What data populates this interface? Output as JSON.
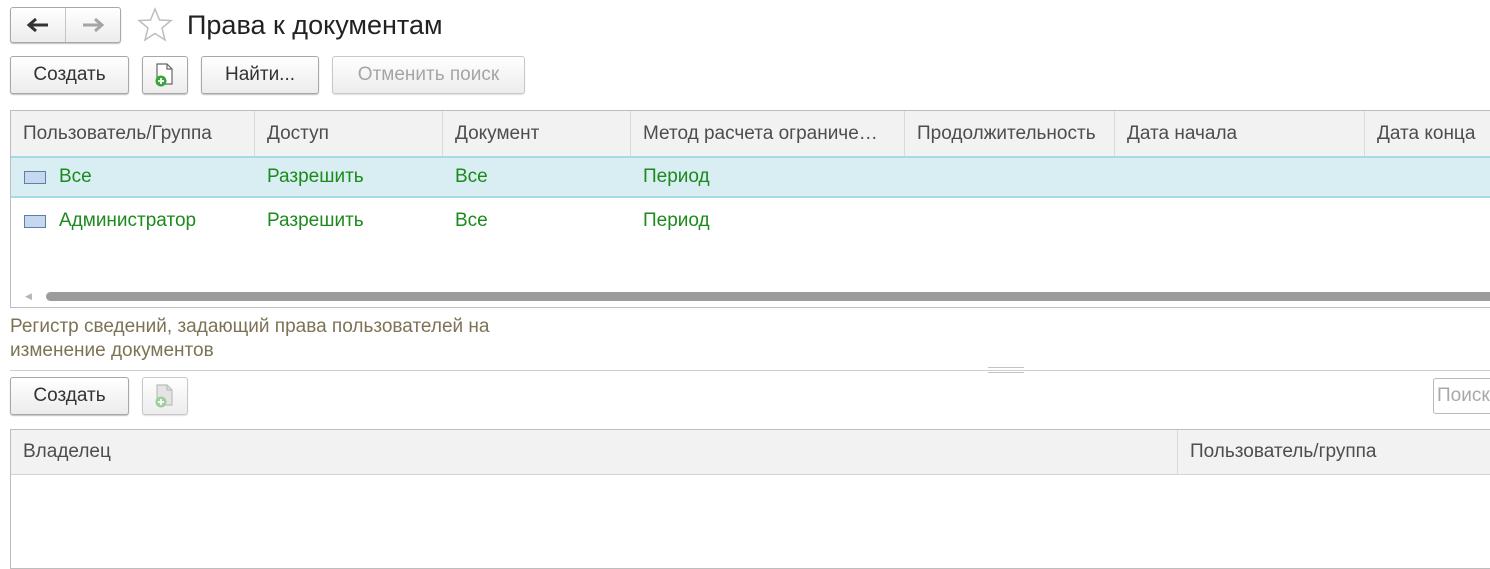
{
  "header": {
    "title": "Права к документам",
    "back_icon": "arrow-left-icon",
    "forward_icon": "arrow-right-icon",
    "favorite_icon": "star-icon"
  },
  "toolbar": {
    "create_label": "Создать",
    "find_label": "Найти...",
    "cancel_search_label": "Отменить поиск"
  },
  "rights_table": {
    "columns": [
      "Пользователь/Группа",
      "Доступ",
      "Документ",
      "Метод расчета ограниче…",
      "Продолжительность",
      "Дата начала",
      "Дата конца"
    ],
    "rows": [
      {
        "user": "Все",
        "access": "Разрешить",
        "document": "Все",
        "method": "Период",
        "selected": true
      },
      {
        "user": "Администратор",
        "access": "Разрешить",
        "document": "Все",
        "method": "Период",
        "selected": false
      }
    ]
  },
  "description": "Регистр сведений, задающий права пользователей на изменение документов",
  "bottom_toolbar": {
    "create_label": "Создать",
    "search_placeholder": "Поиск"
  },
  "owners_table": {
    "columns": [
      "Владелец",
      "Пользователь/группа"
    ]
  },
  "colors": {
    "accent_text": "#1c8a1c",
    "selected_row": "#d8eef2",
    "description_text": "#7c7355"
  }
}
